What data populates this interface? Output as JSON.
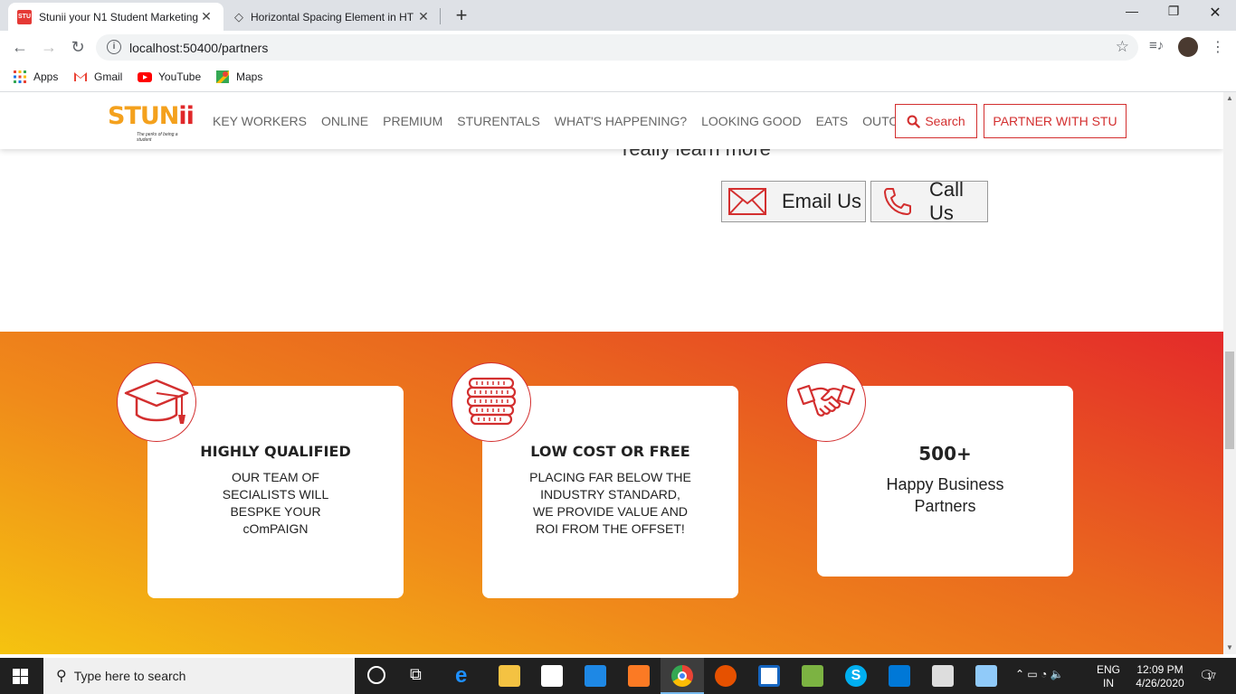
{
  "browser": {
    "tabs": [
      {
        "label": "Stunii your N1 Student Marketing",
        "favicon": "STU",
        "active": true
      },
      {
        "label": "Horizontal Spacing Element in HT",
        "active": false
      }
    ],
    "url": "localhost:50400/partners",
    "bookmarks": [
      "Apps",
      "Gmail",
      "YouTube",
      "Maps"
    ]
  },
  "site": {
    "logo_text": "STUN",
    "logo_ii": "ii",
    "logo_tagline": "The perks of being a student",
    "nav": [
      "KEY WORKERS",
      "ONLINE",
      "PREMIUM",
      "STURENTALS",
      "WHAT'S HAPPENING?",
      "LOOKING GOOD",
      "EATS",
      "OUTOUT"
    ],
    "search_label": "Search",
    "partner_label": "PARTNER WITH STU"
  },
  "hero": {
    "learn_text": "really learn more",
    "email_label": "Email Us",
    "call_label": "Call Us"
  },
  "features": [
    {
      "title": "HIGHLY QUALIFIED",
      "text": "OUR TEAM OF SECIALISTS WILL BESPKE YOUR cOmPAIGN",
      "icon": "graduation-cap-icon"
    },
    {
      "title": "LOW COST OR FREE",
      "text": "PLACING FAR BELOW THE INDUSTRY STANDARD, WE PROVIDE VALUE AND ROI FROM THE OFFSET!",
      "icon": "coins-icon"
    },
    {
      "title": "500+",
      "text": "Happy Business Partners",
      "icon": "handshake-icon"
    }
  ],
  "colors": {
    "accent": "#d32f2f",
    "gradient_start": "#f5c410",
    "gradient_end": "#e42a2a"
  },
  "taskbar": {
    "search_placeholder": "Type here to search",
    "lang": "ENG",
    "region": "IN",
    "time": "12:09 PM",
    "date": "4/26/2020",
    "notifications": "17"
  }
}
